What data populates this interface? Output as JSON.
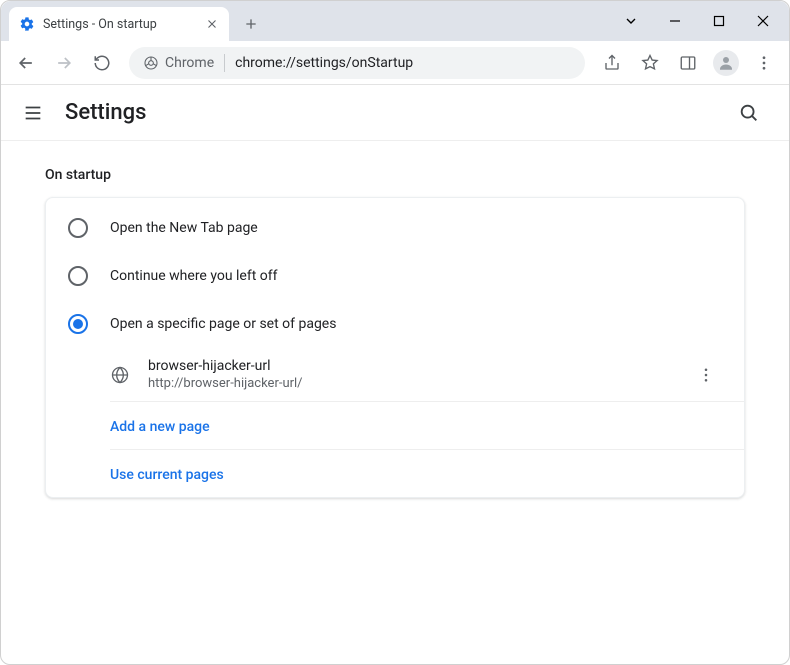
{
  "window": {
    "tab_title": "Settings - On startup"
  },
  "omnibox": {
    "scheme_label": "Chrome",
    "url": "chrome://settings/onStartup"
  },
  "header": {
    "title": "Settings"
  },
  "section": {
    "title": "On startup",
    "options": {
      "new_tab": "Open the New Tab page",
      "continue": "Continue where you left off",
      "specific": "Open a specific page or set of pages"
    },
    "startup_page": {
      "name": "browser-hijacker-url",
      "url": "http://browser-hijacker-url/"
    },
    "add_new_page": "Add a new page",
    "use_current": "Use current pages"
  }
}
